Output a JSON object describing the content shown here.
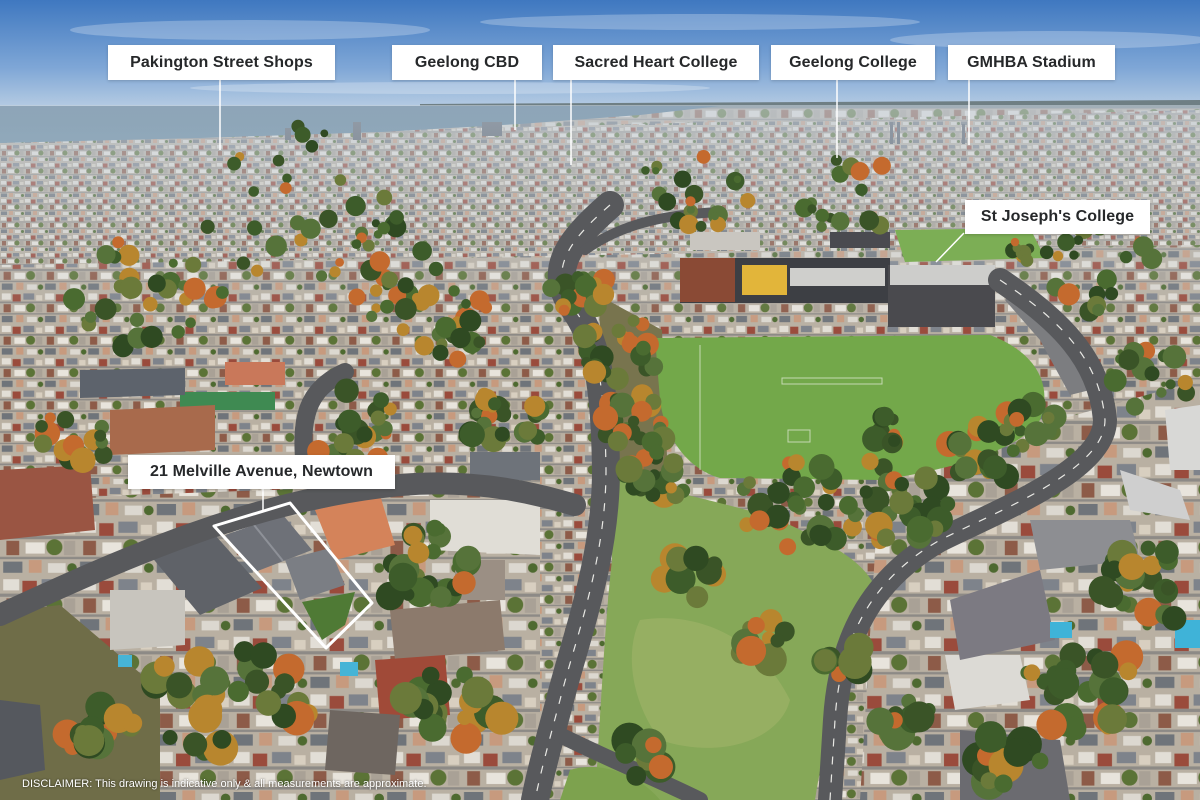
{
  "landmarks": {
    "pakington_street_shops": "Pakington Street Shops",
    "geelong_cbd": "Geelong CBD",
    "sacred_heart_college": "Sacred Heart College",
    "geelong_college": "Geelong College",
    "gmhba_stadium": "GMHBA Stadium",
    "st_josephs_college": "St Joseph's College"
  },
  "property": {
    "address_label": "21 Melville Avenue, Newtown",
    "outline_color": "#ffffff"
  },
  "disclaimer": "DISCLAIMER: This drawing is indicative only & all measurements are approximate.",
  "colors": {
    "label_background": "#ffffff",
    "label_text": "#26282a",
    "sky": "#5b8ed0",
    "sea": "#4b6f8c",
    "grass": "#74a94c",
    "road": "#58595c"
  }
}
